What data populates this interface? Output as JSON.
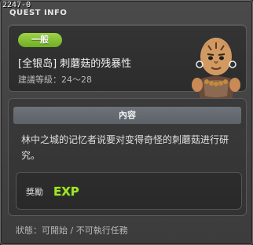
{
  "window": {
    "quest_id": "2247-0",
    "title": "QUEST INFO"
  },
  "header": {
    "grade": "一般",
    "quest_name": "[全银岛] 刺蘑菇的残暴性",
    "level_range": "建議等級：24～28",
    "npc_icon": "npc-portrait-icon"
  },
  "content": {
    "section_title": "內容",
    "description": "林中之城的记忆者说要对变得奇怪的刺蘑菇进行研究。"
  },
  "reward": {
    "label": "獎勵",
    "exp_label": "EXP",
    "exp_icon": "exp-icon"
  },
  "status": {
    "text": "狀態：可開始 / 不可執行任務"
  },
  "colors": {
    "badge_green": "#7fbe2e",
    "exp_green": "#a6e22e"
  }
}
